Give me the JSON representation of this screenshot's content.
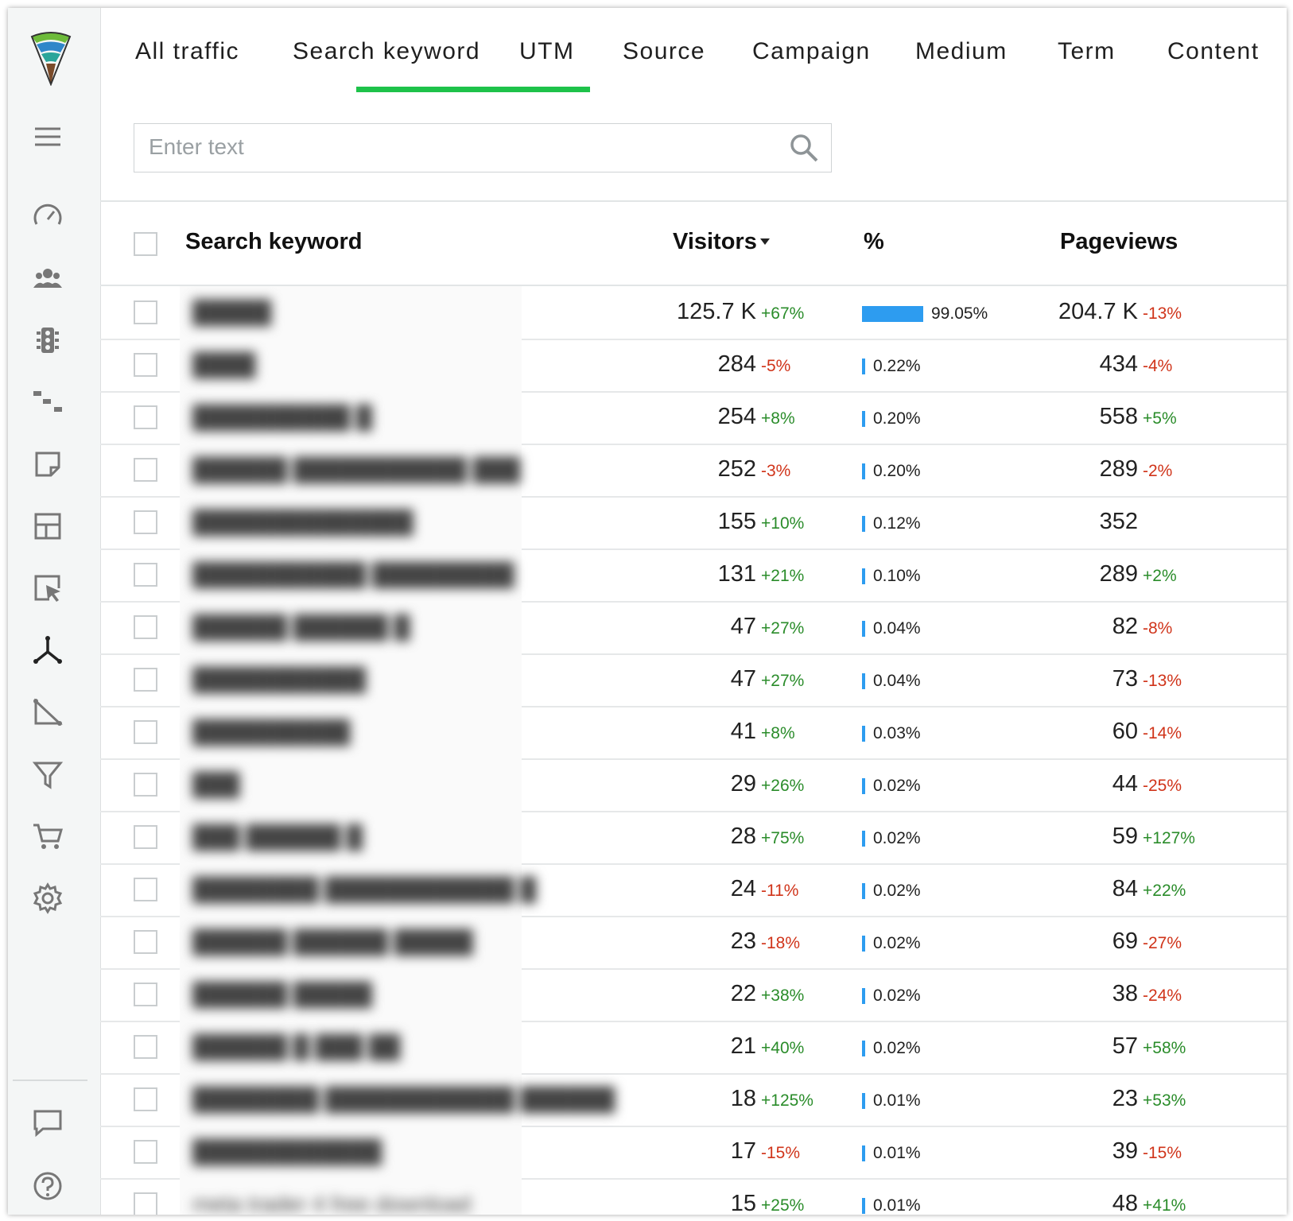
{
  "tabs": [
    "All traffic",
    "Search keyword",
    "UTM",
    "Source",
    "Campaign",
    "Medium",
    "Term",
    "Content"
  ],
  "active_tab": "Search keyword",
  "search": {
    "placeholder": "Enter text",
    "value": ""
  },
  "table": {
    "columns": {
      "keyword": "Search keyword",
      "visitors": "Visitors",
      "percent": "%",
      "pageviews": "Pageviews"
    },
    "sort": {
      "column": "Visitors",
      "direction": "descending"
    },
    "rows": [
      {
        "keyword": "█████",
        "visitors": "125.7 K",
        "visitors_change": "+67%",
        "percent": "99.05%",
        "percent_value": 99.05,
        "pageviews": "204.7 K",
        "pageviews_change": "-13%"
      },
      {
        "keyword": "████",
        "visitors": "284",
        "visitors_change": "-5%",
        "percent": "0.22%",
        "percent_value": 0.22,
        "pageviews": "434",
        "pageviews_change": "-4%"
      },
      {
        "keyword": "██████████ █",
        "visitors": "254",
        "visitors_change": "+8%",
        "percent": "0.20%",
        "percent_value": 0.2,
        "pageviews": "558",
        "pageviews_change": "+5%"
      },
      {
        "keyword": "██████ ███████████ ███",
        "visitors": "252",
        "visitors_change": "-3%",
        "percent": "0.20%",
        "percent_value": 0.2,
        "pageviews": "289",
        "pageviews_change": "-2%"
      },
      {
        "keyword": "██████████████",
        "visitors": "155",
        "visitors_change": "+10%",
        "percent": "0.12%",
        "percent_value": 0.12,
        "pageviews": "352",
        "pageviews_change": ""
      },
      {
        "keyword": "███████████ █████████",
        "visitors": "131",
        "visitors_change": "+21%",
        "percent": "0.10%",
        "percent_value": 0.1,
        "pageviews": "289",
        "pageviews_change": "+2%"
      },
      {
        "keyword": "██████ ██████ █",
        "visitors": "47",
        "visitors_change": "+27%",
        "percent": "0.04%",
        "percent_value": 0.04,
        "pageviews": "82",
        "pageviews_change": "-8%"
      },
      {
        "keyword": "███████████",
        "visitors": "47",
        "visitors_change": "+27%",
        "percent": "0.04%",
        "percent_value": 0.04,
        "pageviews": "73",
        "pageviews_change": "-13%"
      },
      {
        "keyword": "██████████",
        "visitors": "41",
        "visitors_change": "+8%",
        "percent": "0.03%",
        "percent_value": 0.03,
        "pageviews": "60",
        "pageviews_change": "-14%"
      },
      {
        "keyword": "███",
        "visitors": "29",
        "visitors_change": "+26%",
        "percent": "0.02%",
        "percent_value": 0.02,
        "pageviews": "44",
        "pageviews_change": "-25%"
      },
      {
        "keyword": "███ ██████ █",
        "visitors": "28",
        "visitors_change": "+75%",
        "percent": "0.02%",
        "percent_value": 0.02,
        "pageviews": "59",
        "pageviews_change": "+127%"
      },
      {
        "keyword": "████████ ████████████ █",
        "visitors": "24",
        "visitors_change": "-11%",
        "percent": "0.02%",
        "percent_value": 0.02,
        "pageviews": "84",
        "pageviews_change": "+22%"
      },
      {
        "keyword": "██████ ██████ █████",
        "visitors": "23",
        "visitors_change": "-18%",
        "percent": "0.02%",
        "percent_value": 0.02,
        "pageviews": "69",
        "pageviews_change": "-27%"
      },
      {
        "keyword": "██████ █████",
        "visitors": "22",
        "visitors_change": "+38%",
        "percent": "0.02%",
        "percent_value": 0.02,
        "pageviews": "38",
        "pageviews_change": "-24%"
      },
      {
        "keyword": "██████ █ ███ ██",
        "visitors": "21",
        "visitors_change": "+40%",
        "percent": "0.02%",
        "percent_value": 0.02,
        "pageviews": "57",
        "pageviews_change": "+58%"
      },
      {
        "keyword": "████████ ████████████ ██████",
        "visitors": "18",
        "visitors_change": "+125%",
        "percent": "0.01%",
        "percent_value": 0.01,
        "pageviews": "23",
        "pageviews_change": "+53%"
      },
      {
        "keyword": "████████████",
        "visitors": "17",
        "visitors_change": "-15%",
        "percent": "0.01%",
        "percent_value": 0.01,
        "pageviews": "39",
        "pageviews_change": "-15%"
      },
      {
        "keyword": "meta trader 4 free download",
        "visitors": "15",
        "visitors_change": "+25%",
        "percent": "0.01%",
        "percent_value": 0.01,
        "pageviews": "48",
        "pageviews_change": "+41%"
      }
    ]
  },
  "sidebar": {
    "icons": [
      "menu-icon",
      "dashboard-gauge-icon",
      "visitors-icon",
      "traffic-light-icon",
      "flow-icon",
      "notes-icon",
      "layout-icon",
      "click-icon",
      "sources-icon",
      "goals-icon",
      "funnel-icon",
      "cart-icon",
      "settings-icon",
      "chat-icon",
      "help-icon"
    ],
    "active": "sources-icon"
  },
  "colors": {
    "accent_green": "#1ec24a",
    "bar_blue": "#2d9cf0",
    "positive": "#2a8c2a",
    "negative": "#d0341a"
  }
}
